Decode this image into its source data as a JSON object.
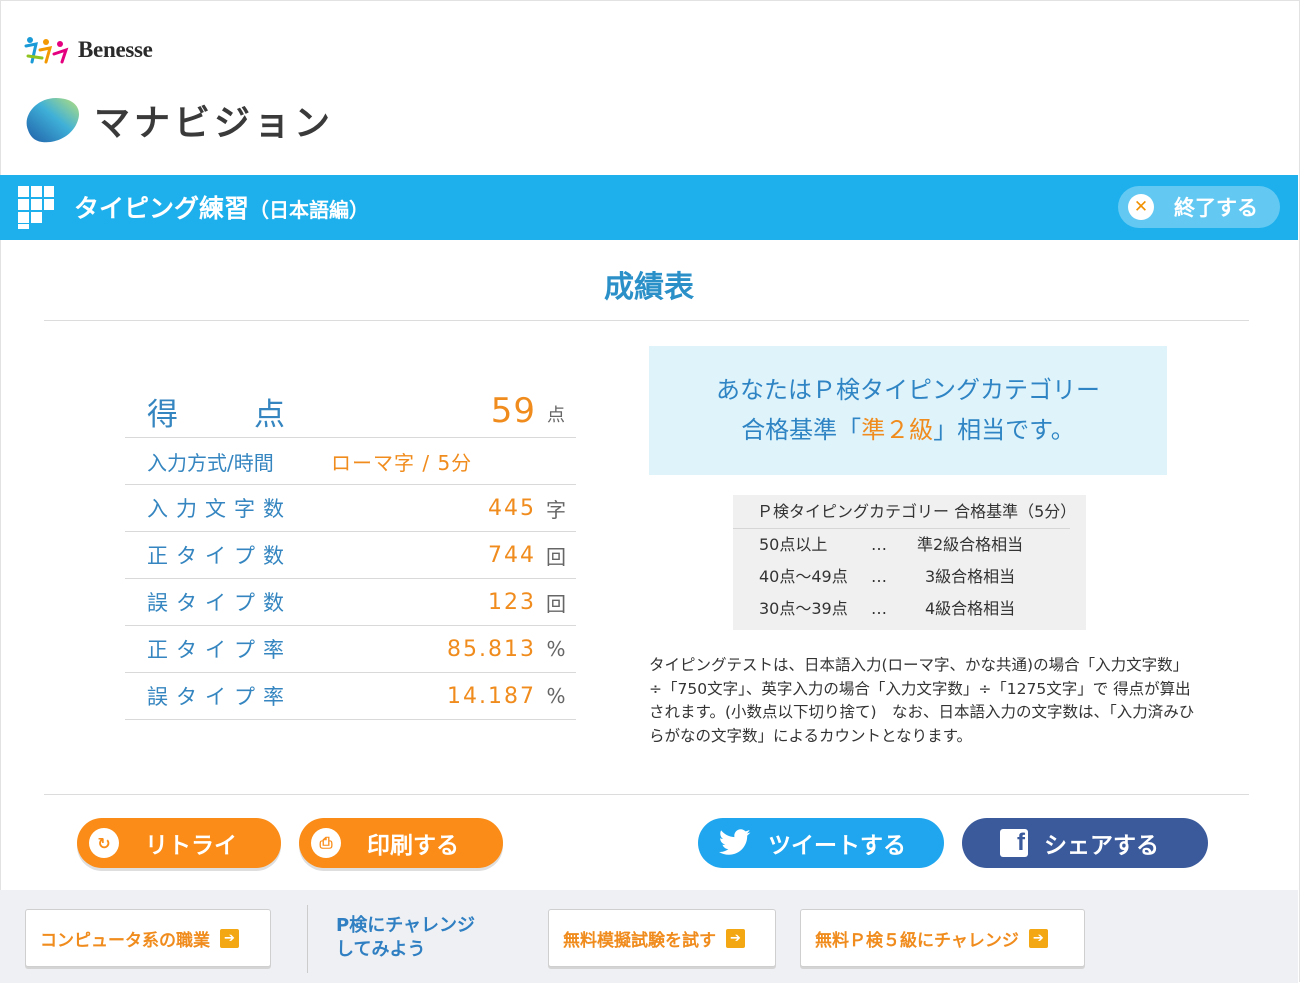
{
  "brand": {
    "benesse": "Benesse",
    "manavision": "マナビジョン"
  },
  "header": {
    "title": "タイピング練習",
    "subtitle": "（日本語編）",
    "exit_label": "終了する"
  },
  "page_title": "成績表",
  "score": {
    "label_a": "得",
    "label_b": "点",
    "value": "59",
    "unit": "点",
    "rows": [
      {
        "label": "入力方式/時間",
        "value": "ローマ字 / 5分",
        "unit": ""
      },
      {
        "label": "入力文字数",
        "value": "445",
        "unit": "字"
      },
      {
        "label": "正タイプ数",
        "value": "744",
        "unit": "回"
      },
      {
        "label": "誤タイプ数",
        "value": "123",
        "unit": "回"
      },
      {
        "label": "正タイプ率",
        "value": "85.813",
        "unit": "%"
      },
      {
        "label": "誤タイプ率",
        "value": "14.187",
        "unit": "%"
      }
    ]
  },
  "result": {
    "line1": "あなたはＰ検タイピングカテゴリー",
    "line2_pre": "合格基準「",
    "line2_grade": "準２級",
    "line2_post": "」相当です。"
  },
  "criteria": {
    "header": "Ｐ検タイピングカテゴリー 合格基準（5分）",
    "rows": [
      {
        "range": "50点以上",
        "dots": "…",
        "level": "準2級合格相当"
      },
      {
        "range": "40点～49点",
        "dots": "…",
        "level": "3級合格相当"
      },
      {
        "range": "30点～39点",
        "dots": "…",
        "level": "4級合格相当"
      }
    ]
  },
  "note": "タイピングテストは、日本語入力(ローマ字、かな共通)の場合「入力文字数」÷「750文字」、英字入力の場合「入力文字数」÷「1275文字」で 得点が算出されます。(小数点以下切り捨て)　なお、日本語入力の文字数は、「入力済みひらがなの文字数」によるカウントとなります。",
  "actions": {
    "retry": "リトライ",
    "print": "印刷する",
    "tweet": "ツイートする",
    "share": "シェアする"
  },
  "footer": {
    "link1": "コンピュータ系の職業",
    "challenge_line1": "P検にチャレンジ",
    "challenge_line2": "してみよう",
    "link2": "無料模擬試験を試す",
    "link3": "無料Ｐ検５級にチャレンジ"
  },
  "colors": {
    "accent": "#1eb0ec",
    "orange": "#fa8c17",
    "twitter": "#1fa6ee",
    "facebook": "#3a5a9c"
  }
}
